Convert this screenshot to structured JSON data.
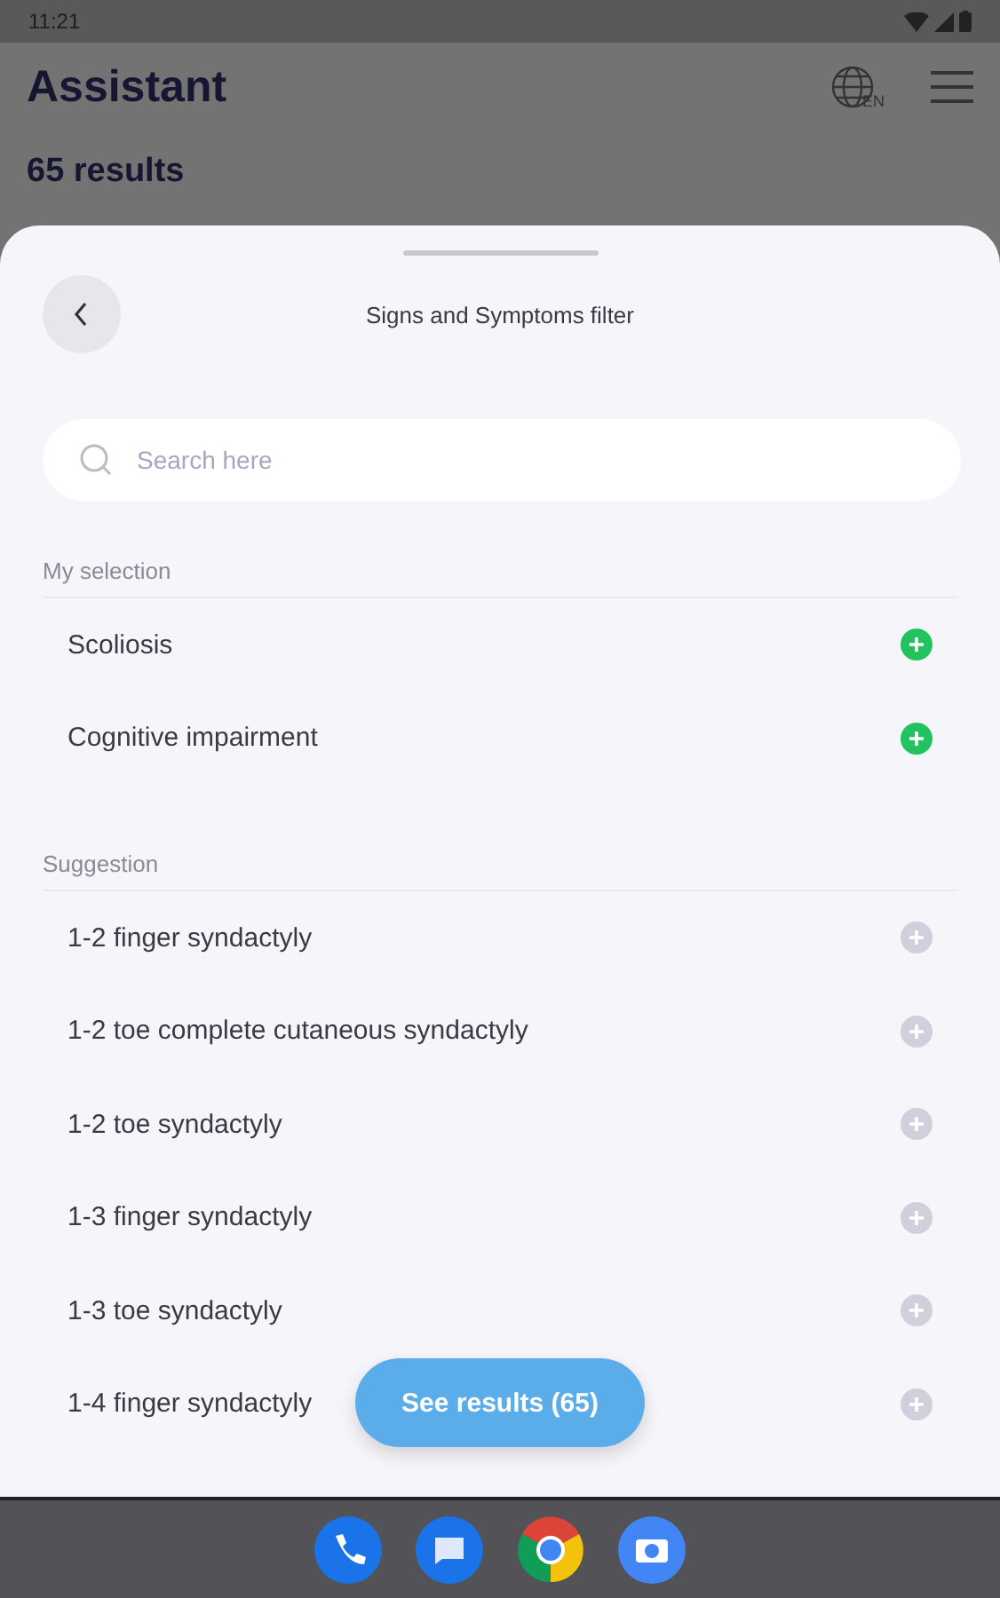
{
  "status_bar": {
    "time": "11:21"
  },
  "background": {
    "title": "Assistant",
    "language": "EN",
    "results": "65 results"
  },
  "sheet": {
    "title": "Signs and Symptoms filter",
    "search": {
      "placeholder": "Search here"
    },
    "sections": [
      {
        "heading": "My selection",
        "items": [
          {
            "label": "Scoliosis",
            "selected": true
          },
          {
            "label": "Cognitive impairment",
            "selected": true
          }
        ]
      },
      {
        "heading": "Suggestion",
        "items": [
          {
            "label": "1-2 finger syndactyly",
            "selected": false
          },
          {
            "label": "1-2 toe complete cutaneous syndactyly",
            "selected": false
          },
          {
            "label": "1-2 toe syndactyly",
            "selected": false
          },
          {
            "label": "1-3 finger syndactyly",
            "selected": false
          },
          {
            "label": "1-3 toe syndactyly",
            "selected": false
          },
          {
            "label": "1-4 finger syndactyly",
            "selected": false
          }
        ]
      }
    ],
    "button": "See results (65)"
  }
}
